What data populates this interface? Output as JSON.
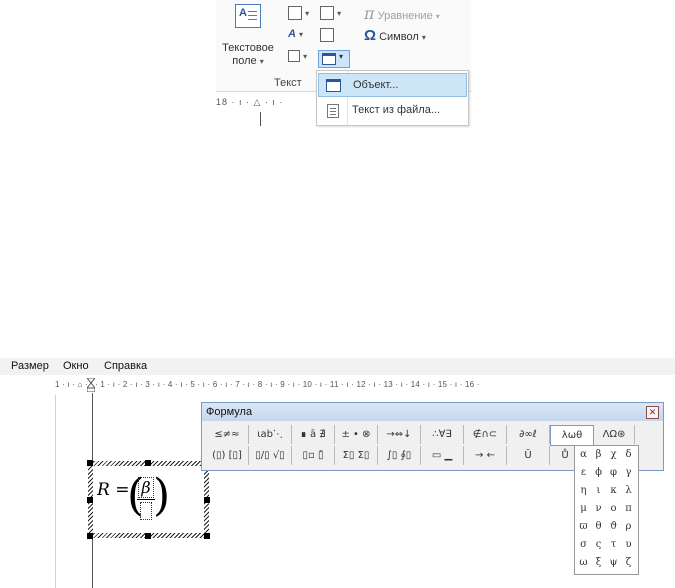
{
  "ribbon": {
    "textbox_label_line1": "Текстовое",
    "textbox_label_line2": "поле",
    "caret": "▾",
    "equation_label": "Уравнение",
    "symbol_label": "Символ",
    "group_label": "Текст",
    "pi_glyph": "π",
    "omega_glyph": "Ω",
    "quickparts_glyph": "A",
    "ruler_text": "18 · ı · △ · ı ·"
  },
  "dropdown": {
    "items": [
      {
        "label": "Объект...",
        "icon": "window-object-icon",
        "highlighted": true
      },
      {
        "label": "Текст из файла...",
        "icon": "text-file-icon",
        "highlighted": false
      }
    ]
  },
  "menubar": {
    "items": [
      "Размер",
      "Окно",
      "Справка"
    ]
  },
  "ruler": {
    "ticks": "1 · ı · ⌂ · ı · 1 · ı · 2 · ı · 3 · ı · 4 · ı · 5 · ı · 6 · ı · 7 · ı · 8 · ı · 9 · ı · 10 · ı · 11 · ı · 12 · ı · 13 · ı · 14 · ı · 15 · ı · 16 ·"
  },
  "formula_toolbar": {
    "title": "Формула",
    "close_glyph": "✕",
    "row1": [
      "≤≠≈",
      "⍳ab⋱",
      "∎ ā ∄",
      "± • ⊗",
      "→⇔↓",
      "∴∀∃",
      "∉∩⊂",
      "∂∞ℓ",
      "λωθ",
      "ΛΩ⊛"
    ],
    "row2": [
      "(▯) [▯]",
      "▯/▯ √▯",
      "▯▫ ▯̄",
      "Σ▯ Σ▯",
      "∫▯ ∮▯",
      "▭ ▁",
      "→ ←",
      "Ū",
      "Ů"
    ]
  },
  "formula": {
    "lhs": "R =",
    "paren_left": "(",
    "paren_right": ")",
    "numerator": "β"
  },
  "greek_palette": {
    "symbols": [
      "α",
      "β",
      "χ",
      "δ",
      "ε",
      "ϕ",
      "φ",
      "γ",
      "η",
      "ι",
      "κ",
      "λ",
      "μ",
      "ν",
      "ο",
      "π",
      "ϖ",
      "θ",
      "ϑ",
      "ρ",
      "σ",
      "ς",
      "τ",
      "υ",
      "ω",
      "ξ",
      "ψ",
      "ζ"
    ]
  }
}
